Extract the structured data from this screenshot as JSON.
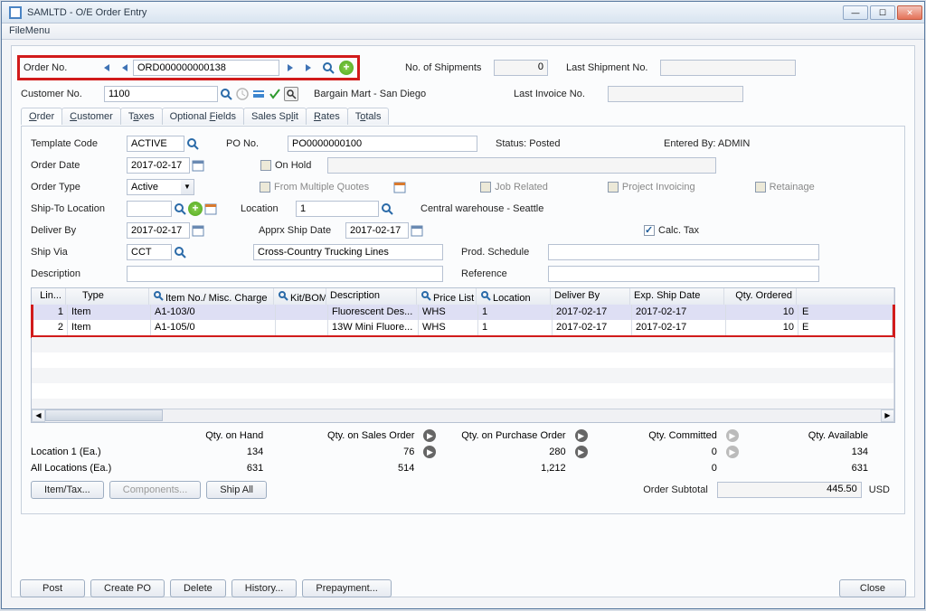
{
  "window": {
    "title": "SAMLTD - O/E Order Entry",
    "menu": "FileMenu"
  },
  "header": {
    "order_no_label": "Order No.",
    "order_no": "ORD000000000138",
    "no_shipments_label": "No. of Shipments",
    "no_shipments": "0",
    "last_shipment_label": "Last Shipment No.",
    "last_shipment": "",
    "customer_no_label": "Customer No.",
    "customer_no": "1100",
    "customer_name": "Bargain Mart - San Diego",
    "last_invoice_label": "Last Invoice No.",
    "last_invoice": ""
  },
  "tabs": [
    "Order",
    "Customer",
    "Taxes",
    "Optional Fields",
    "Sales Split",
    "Rates",
    "Totals"
  ],
  "order": {
    "template_label": "Template Code",
    "template": "ACTIVE",
    "po_label": "PO No.",
    "po": "PO0000000100",
    "status": "Status: Posted",
    "entered_by": "Entered By: ADMIN",
    "order_date_label": "Order Date",
    "order_date": "2017-02-17",
    "onhold": "On Hold",
    "order_type_label": "Order Type",
    "order_type": "Active",
    "multi_quotes": "From Multiple Quotes",
    "job": "Job Related",
    "proj": "Project Invoicing",
    "retain": "Retainage",
    "shipto_label": "Ship-To Location",
    "shipto": "",
    "location_label": "Location",
    "location": "1",
    "loc_desc": "Central warehouse - Seattle",
    "deliver_label": "Deliver By",
    "deliver": "2017-02-17",
    "apprx_label": "Apprx Ship Date",
    "apprx": "2017-02-17",
    "calc_tax": "Calc. Tax",
    "shipvia_label": "Ship Via",
    "shipvia": "CCT",
    "shipvia_desc": "Cross-Country Trucking Lines",
    "schedule_label": "Prod. Schedule",
    "schedule": "",
    "desc_label": "Description",
    "desc": "",
    "ref_label": "Reference",
    "ref": ""
  },
  "grid": {
    "cols": [
      "Lin...",
      "Type",
      "Item No./ Misc. Charge",
      "Kit/BOM",
      "Description",
      "Price List",
      "Location",
      "Deliver By",
      "Exp. Ship Date",
      "Qty. Ordered"
    ],
    "rows": [
      {
        "line": "1",
        "type": "Item",
        "item": "A1-103/0",
        "kit": "",
        "desc": "Fluorescent Des...",
        "price": "WHS",
        "loc": "1",
        "deliver": "2017-02-17",
        "exp": "2017-02-17",
        "qty": "10",
        "unit": "E"
      },
      {
        "line": "2",
        "type": "Item",
        "item": "A1-105/0",
        "kit": "",
        "desc": "13W Mini Fluore...",
        "price": "WHS",
        "loc": "1",
        "deliver": "2017-02-17",
        "exp": "2017-02-17",
        "qty": "10",
        "unit": "E"
      }
    ]
  },
  "qty": {
    "hdrs": [
      "Qty. on Hand",
      "Qty. on Sales Order",
      "Qty. on Purchase Order",
      "Qty. Committed",
      "Qty. Available"
    ],
    "rows": [
      {
        "label": "Location  1 (Ea.)",
        "v": [
          "134",
          "76",
          "280",
          "0",
          "134"
        ]
      },
      {
        "label": "All Locations (Ea.)",
        "v": [
          "631",
          "514",
          "1,212",
          "0",
          "631"
        ]
      }
    ]
  },
  "buttons": {
    "item_tax": "Item/Tax...",
    "components": "Components...",
    "ship_all": "Ship All",
    "post": "Post",
    "create_po": "Create PO",
    "delete": "Delete",
    "history": "History...",
    "prepayment": "Prepayment...",
    "close": "Close"
  },
  "subtotal": {
    "label": "Order Subtotal",
    "amount": "445.50",
    "currency": "USD"
  }
}
